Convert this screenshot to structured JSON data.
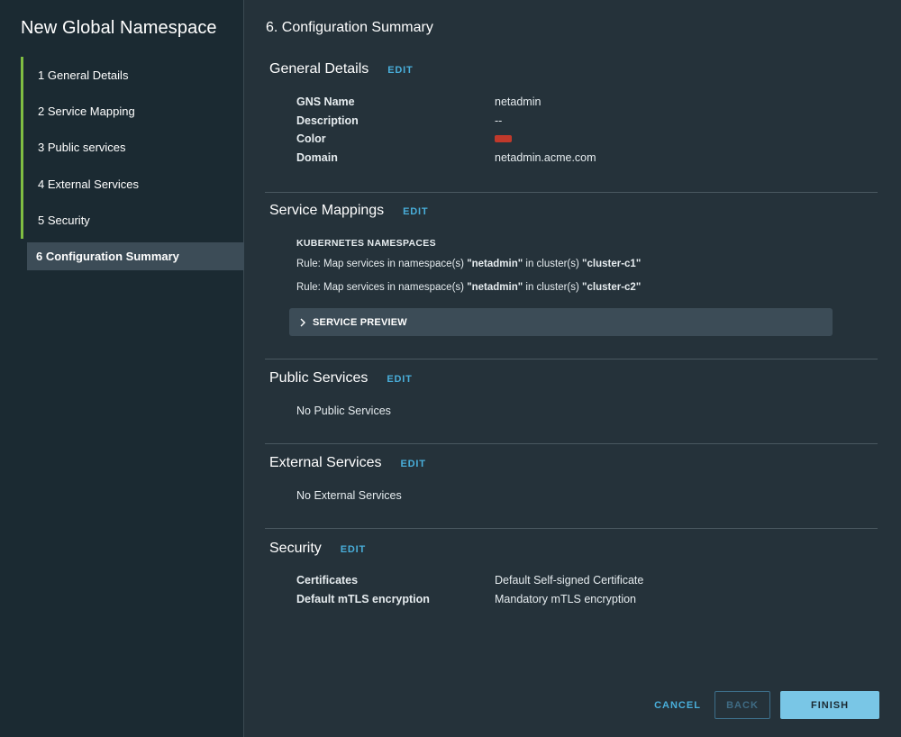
{
  "sidebar": {
    "title": "New Global Namespace",
    "steps": [
      {
        "label": "1 General Details"
      },
      {
        "label": "2 Service Mapping"
      },
      {
        "label": "3 Public services"
      },
      {
        "label": "4 External Services"
      },
      {
        "label": "5 Security"
      },
      {
        "label": "6 Configuration Summary"
      }
    ]
  },
  "main": {
    "title": "6. Configuration Summary",
    "edit_label": "EDIT",
    "general": {
      "title": "General Details",
      "rows": [
        {
          "key": "GNS Name",
          "value": "netadmin"
        },
        {
          "key": "Description",
          "value": "--"
        },
        {
          "key": "Color",
          "value": "",
          "swatch": "#c0392b"
        },
        {
          "key": "Domain",
          "value": "netadmin.acme.com"
        }
      ]
    },
    "mappings": {
      "title": "Service Mappings",
      "subhead": "KUBERNETES NAMESPACES",
      "rules": [
        {
          "prefix": "Rule: Map services in namespace(s) ",
          "namespace": "\"netadmin\"",
          "mid": " in cluster(s) ",
          "cluster": "\"cluster-c1\""
        },
        {
          "prefix": "Rule: Map services in namespace(s) ",
          "namespace": "\"netadmin\"",
          "mid": " in cluster(s) ",
          "cluster": "\"cluster-c2\""
        }
      ],
      "preview_label": "SERVICE PREVIEW"
    },
    "public": {
      "title": "Public Services",
      "empty": "No Public Services"
    },
    "external": {
      "title": "External Services",
      "empty": "No External Services"
    },
    "security": {
      "title": "Security",
      "rows": [
        {
          "key": "Certificates",
          "value": "Default Self-signed Certificate"
        },
        {
          "key": "Default mTLS encryption",
          "value": "Mandatory mTLS encryption"
        }
      ]
    }
  },
  "footer": {
    "cancel": "CANCEL",
    "back": "BACK",
    "finish": "FINISH"
  }
}
